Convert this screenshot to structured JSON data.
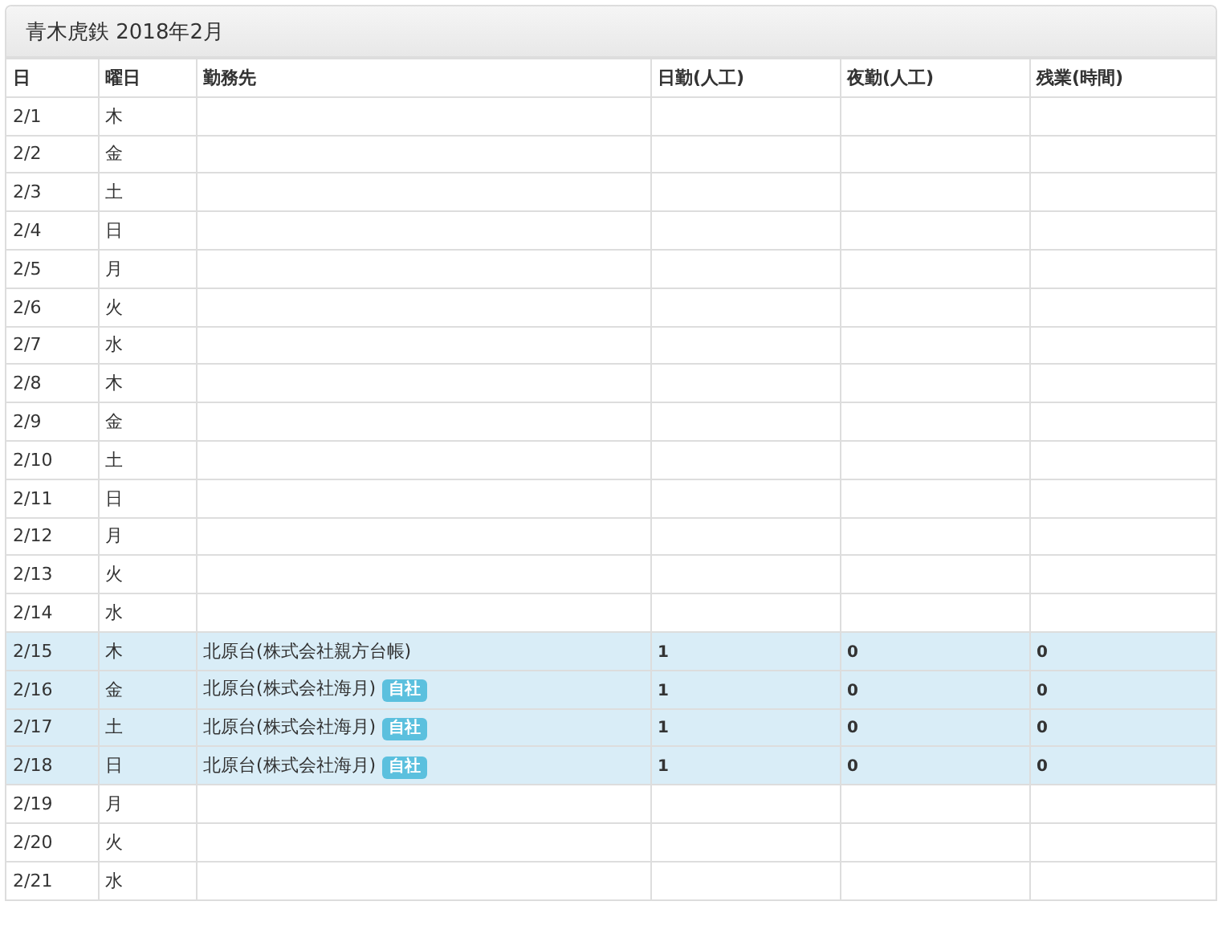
{
  "panel": {
    "title": "青木虎鉄 2018年2月"
  },
  "table": {
    "columns": [
      "日",
      "曜日",
      "勤務先",
      "日勤(人工)",
      "夜勤(人工)",
      "残業(時間)"
    ],
    "rows": [
      {
        "date": "2/1",
        "weekday": "木",
        "highlighted": false
      },
      {
        "date": "2/2",
        "weekday": "金",
        "highlighted": false
      },
      {
        "date": "2/3",
        "weekday": "土",
        "highlighted": false
      },
      {
        "date": "2/4",
        "weekday": "日",
        "highlighted": false
      },
      {
        "date": "2/5",
        "weekday": "月",
        "highlighted": false
      },
      {
        "date": "2/6",
        "weekday": "火",
        "highlighted": false
      },
      {
        "date": "2/7",
        "weekday": "水",
        "highlighted": false
      },
      {
        "date": "2/8",
        "weekday": "木",
        "highlighted": false
      },
      {
        "date": "2/9",
        "weekday": "金",
        "highlighted": false
      },
      {
        "date": "2/10",
        "weekday": "土",
        "highlighted": false
      },
      {
        "date": "2/11",
        "weekday": "日",
        "highlighted": false
      },
      {
        "date": "2/12",
        "weekday": "月",
        "highlighted": false
      },
      {
        "date": "2/13",
        "weekday": "火",
        "highlighted": false
      },
      {
        "date": "2/14",
        "weekday": "水",
        "highlighted": false
      },
      {
        "date": "2/15",
        "weekday": "木",
        "site": "北原台(株式会社親方台帳)",
        "day_shift": "1",
        "night_shift": "0",
        "overtime": "0",
        "highlighted": true
      },
      {
        "date": "2/16",
        "weekday": "金",
        "site": "北原台(株式会社海月)",
        "badge": "自社",
        "day_shift": "1",
        "night_shift": "0",
        "overtime": "0",
        "highlighted": true
      },
      {
        "date": "2/17",
        "weekday": "土",
        "site": "北原台(株式会社海月)",
        "badge": "自社",
        "day_shift": "1",
        "night_shift": "0",
        "overtime": "0",
        "highlighted": true
      },
      {
        "date": "2/18",
        "weekday": "日",
        "site": "北原台(株式会社海月)",
        "badge": "自社",
        "day_shift": "1",
        "night_shift": "0",
        "overtime": "0",
        "highlighted": true
      },
      {
        "date": "2/19",
        "weekday": "月",
        "highlighted": false
      },
      {
        "date": "2/20",
        "weekday": "火",
        "highlighted": false
      },
      {
        "date": "2/21",
        "weekday": "水",
        "highlighted": false
      }
    ]
  }
}
